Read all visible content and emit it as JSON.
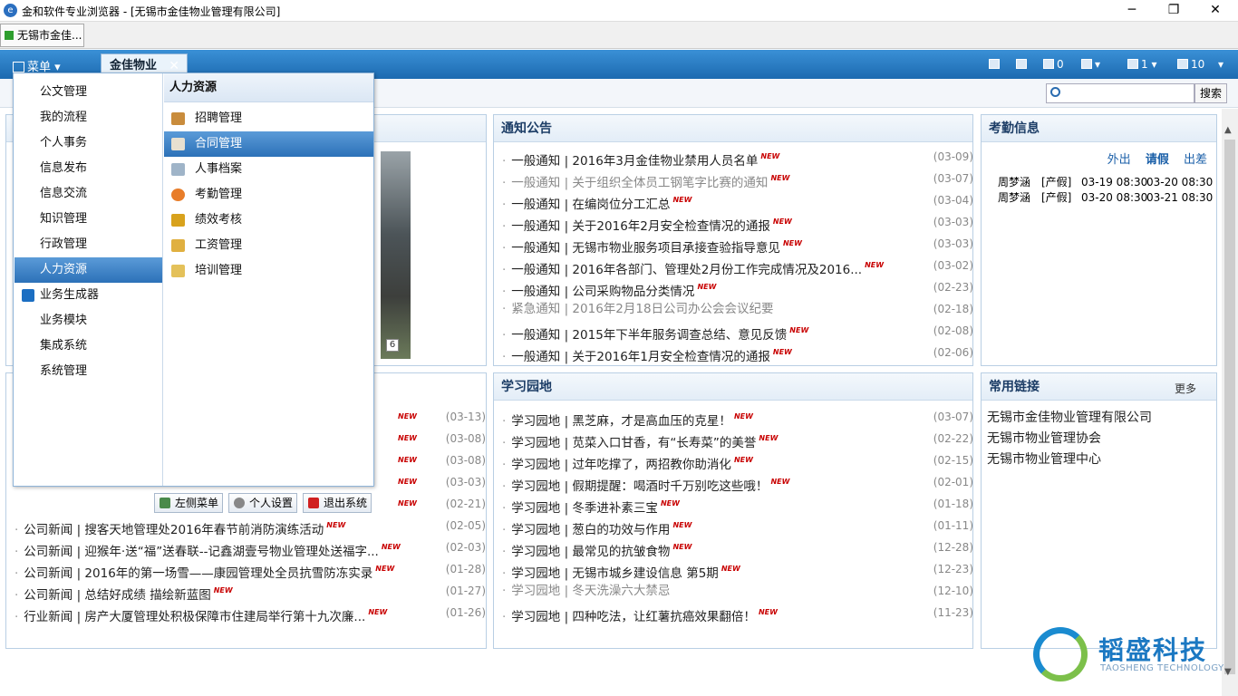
{
  "window": {
    "title": "金和软件专业浏览器 - [无锡市金佳物业管理有限公司]",
    "min": "─",
    "max": "❐",
    "close": "✕"
  },
  "browser_tab": {
    "label": "无锡市金佳..."
  },
  "topbar": {
    "menu_label": "菜单",
    "app_tab": "金佳物业",
    "app_tab_close": "✕",
    "msg_count": "0",
    "notify_count": "1",
    "user_count": "10"
  },
  "search": {
    "placeholder": "",
    "button": "搜索"
  },
  "menu": {
    "left_items": [
      "公文管理",
      "我的流程",
      "个人事务",
      "信息发布",
      "信息交流",
      "知识管理",
      "行政管理",
      "人力资源",
      "业务生成器",
      "业务模块",
      "集成系统",
      "系统管理"
    ],
    "right_title": "人力资源",
    "right_items": [
      "招聘管理",
      "合同管理",
      "人事档案",
      "考勤管理",
      "绩效考核",
      "工资管理",
      "培训管理"
    ],
    "buttons": [
      "左侧菜单",
      "个人设置",
      "退出系统"
    ]
  },
  "photo": {
    "counter": "6"
  },
  "notice": {
    "title": "通知公告",
    "items": [
      {
        "text": "一般通知 | 2016年3月金佳物业禁用人员名单",
        "date": "(03-09)",
        "new": "NEW"
      },
      {
        "text": "一般通知 | 关于组织全体员工钢笔字比赛的通知",
        "date": "(03-07)",
        "new": "NEW"
      },
      {
        "text": "一般通知 | 在编岗位分工汇总",
        "date": "(03-04)",
        "new": "NEW"
      },
      {
        "text": "一般通知 | 关于2016年2月安全检查情况的通报",
        "date": "(03-03)",
        "new": "NEW"
      },
      {
        "text": "一般通知 | 无锡市物业服务项目承接查验指导意见",
        "date": "(03-03)",
        "new": "NEW"
      },
      {
        "text": "一般通知 | 2016年各部门、管理处2月份工作完成情况及2016...",
        "date": "(03-02)",
        "new": "NEW"
      },
      {
        "text": "一般通知 | 公司采购物品分类情况",
        "date": "(02-23)",
        "new": "NEW"
      },
      {
        "text": "紧急通知 | 2016年2月18日公司办公会会议纪要",
        "date": "(02-18)",
        "new": ""
      },
      {
        "text": "一般通知 | 2015年下半年服务调查总结、意见反馈",
        "date": "(02-08)",
        "new": "NEW"
      },
      {
        "text": "一般通知 | 关于2016年1月安全检查情况的通报",
        "date": "(02-06)",
        "new": "NEW"
      }
    ]
  },
  "attendance": {
    "title": "考勤信息",
    "links": [
      "外出",
      "请假",
      "出差"
    ],
    "rows": [
      {
        "name": "周梦涵",
        "type": "[产假]",
        "start": "03-19 08:30",
        "end": "03-20 08:30"
      },
      {
        "name": "周梦涵",
        "type": "[产假]",
        "start": "03-20 08:30",
        "end": "03-21 08:30"
      }
    ]
  },
  "news": {
    "items": [
      {
        "text": "",
        "date": "(03-13)",
        "new": "NEW"
      },
      {
        "text": "",
        "date": "(03-08)",
        "new": "NEW"
      },
      {
        "text": "",
        "date": "(03-08)",
        "new": "NEW"
      },
      {
        "text": "",
        "date": "(03-03)",
        "new": "NEW"
      },
      {
        "text": "",
        "date": "(02-21)",
        "new": "NEW"
      },
      {
        "text": "公司新闻 | 搜客天地管理处2016年春节前消防演练活动",
        "date": "(02-05)",
        "new": "NEW"
      },
      {
        "text": "公司新闻 | 迎猴年·送“福”送春联--记鑫湖壹号物业管理处送福字...",
        "date": "(02-03)",
        "new": "NEW"
      },
      {
        "text": "公司新闻 | 2016年的第一场雪——康园管理处全员抗雪防冻实录",
        "date": "(01-28)",
        "new": "NEW"
      },
      {
        "text": "公司新闻 | 总结好成绩 描绘新蓝图",
        "date": "(01-27)",
        "new": "NEW"
      },
      {
        "text": "行业新闻 | 房产大厦管理处积极保障市住建局举行第十九次廉...",
        "date": "(01-26)",
        "new": "NEW"
      }
    ]
  },
  "study": {
    "title": "学习园地",
    "items": [
      {
        "text": "学习园地 | 黑芝麻，才是高血压的克星！",
        "date": "(03-07)",
        "new": "NEW"
      },
      {
        "text": "学习园地 | 苋菜入口甘香，有“长寿菜”的美誉",
        "date": "(02-22)",
        "new": "NEW"
      },
      {
        "text": "学习园地 | 过年吃撑了，两招教你助消化",
        "date": "(02-15)",
        "new": "NEW"
      },
      {
        "text": "学习园地 | 假期提醒：喝酒时千万别吃这些哦！",
        "date": "(02-01)",
        "new": "NEW"
      },
      {
        "text": "学习园地 | 冬季进补素三宝",
        "date": "(01-18)",
        "new": "NEW"
      },
      {
        "text": "学习园地 | 葱白的功效与作用",
        "date": "(01-11)",
        "new": "NEW"
      },
      {
        "text": "学习园地 | 最常见的抗皱食物",
        "date": "(12-28)",
        "new": "NEW"
      },
      {
        "text": "学习园地 | 无锡市城乡建设信息 第5期",
        "date": "(12-23)",
        "new": "NEW"
      },
      {
        "text": "学习园地 | 冬天洗澡六大禁忌",
        "date": "(12-10)",
        "new": ""
      },
      {
        "text": "学习园地 | 四种吃法，让红薯抗癌效果翻倍！",
        "date": "(11-23)",
        "new": "NEW"
      }
    ]
  },
  "links": {
    "title": "常用链接",
    "more": "更多",
    "items": [
      "无锡市金佳物业管理有限公司",
      "无锡市物业管理协会",
      "无锡市物业管理中心"
    ]
  },
  "logo": {
    "cn": "韬盛科技",
    "en": "TAOSHENG TECHNOLOGY"
  },
  "colors": {
    "accent": "#1d6ab0",
    "menu_selected": "#2c71b8",
    "new_badge": "#c80000"
  }
}
